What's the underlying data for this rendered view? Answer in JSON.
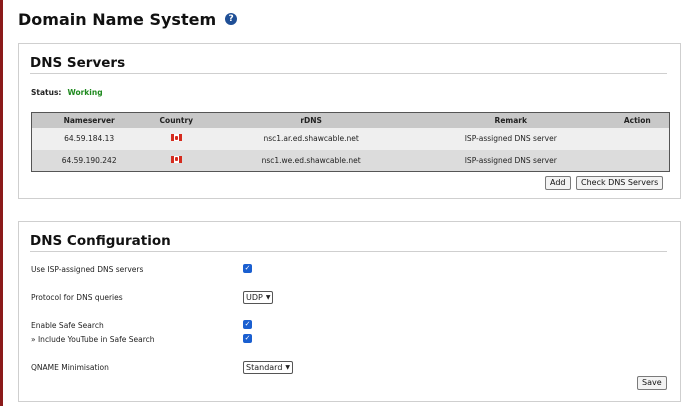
{
  "page": {
    "title": "Domain Name System"
  },
  "servers": {
    "title": "DNS Servers",
    "status_label": "Status:",
    "status_value": "Working",
    "columns": [
      "Nameserver",
      "Country",
      "rDNS",
      "Remark",
      "Action"
    ],
    "rows": [
      {
        "nameserver": "64.59.184.13",
        "country_flag": "canada-flag-icon",
        "rdns": "nsc1.ar.ed.shawcable.net",
        "remark": "ISP-assigned DNS server",
        "action": ""
      },
      {
        "nameserver": "64.59.190.242",
        "country_flag": "canada-flag-icon",
        "rdns": "nsc1.we.ed.shawcable.net",
        "remark": "ISP-assigned DNS server",
        "action": ""
      }
    ],
    "add_label": "Add",
    "check_label": "Check DNS Servers"
  },
  "config": {
    "title": "DNS Configuration",
    "use_isp_label": "Use ISP-assigned DNS servers",
    "use_isp_checked": true,
    "protocol_label": "Protocol for DNS queries",
    "protocol_value": "UDP",
    "safe_search_label": "Enable Safe Search",
    "safe_search_checked": true,
    "youtube_label": "» Include YouTube in Safe Search",
    "youtube_checked": true,
    "qname_label": "QNAME Minimisation",
    "qname_value": "Standard",
    "save_label": "Save"
  },
  "colors": {
    "accent": "#1a5fd0",
    "status_ok": "#1f8a1f",
    "header_bg": "#c8c8c8"
  }
}
